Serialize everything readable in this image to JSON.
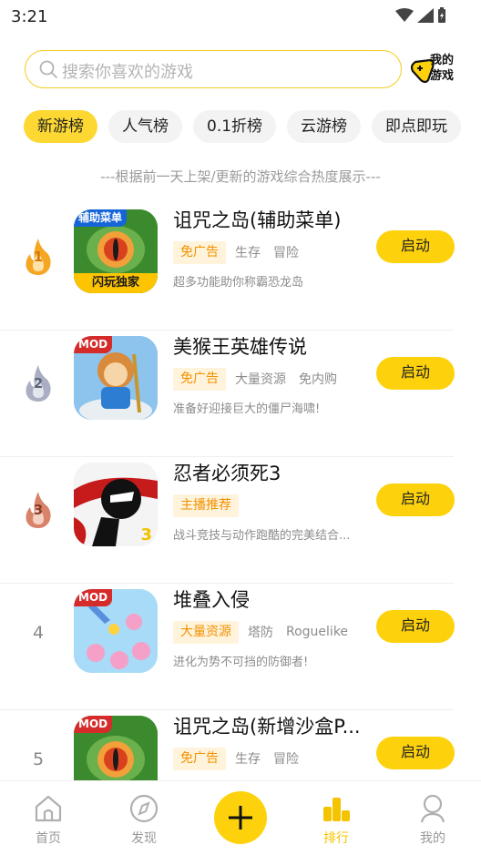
{
  "status_bar": {
    "time": "3:21"
  },
  "search": {
    "placeholder": "搜索你喜欢的游戏"
  },
  "my_games": {
    "line1": "我的",
    "line2": "游戏"
  },
  "tabs": [
    {
      "label": "新游榜",
      "active": true
    },
    {
      "label": "人气榜",
      "active": false
    },
    {
      "label": "0.1折榜",
      "active": false
    },
    {
      "label": "云游榜",
      "active": false
    },
    {
      "label": "即点即玩",
      "active": false
    }
  ],
  "notice": "---根据前一天上架/更新的游戏综合热度展示---",
  "games": [
    {
      "rank": "1",
      "title": "诅咒之岛(辅助菜单)",
      "highlight_tag": "免广告",
      "tags": [
        "生存",
        "冒险"
      ],
      "desc": "超多功能助你称霸恐龙岛",
      "button": "启动",
      "icon_badge": "辅助菜单",
      "icon_bottom": "闪玩独家"
    },
    {
      "rank": "2",
      "title": "美猴王英雄传说",
      "highlight_tag": "免广告",
      "tags": [
        "大量资源",
        "免内购"
      ],
      "desc": "准备好迎接巨大的僵尸海啸!",
      "button": "启动",
      "icon_badge": "MOD"
    },
    {
      "rank": "3",
      "title": "忍者必须死3",
      "highlight_tag": "主播推荐",
      "tags": [],
      "desc": "战斗竞技与动作跑酷的完美结合...",
      "button": "启动",
      "icon_corner": "3"
    },
    {
      "rank": "4",
      "title": "堆叠入侵",
      "highlight_tag": "大量资源",
      "tags": [
        "塔防",
        "Roguelike"
      ],
      "desc": "进化为势不可挡的防御者!",
      "button": "启动",
      "icon_badge": "MOD"
    },
    {
      "rank": "5",
      "title": "诅咒之岛(新增沙盒P...",
      "highlight_tag": "免广告",
      "tags": [
        "生存",
        "冒险"
      ],
      "desc": "",
      "button": "启动",
      "icon_badge": "MOD"
    }
  ],
  "bottom_nav": [
    {
      "label": "首页",
      "icon": "home-icon",
      "active": false
    },
    {
      "label": "发现",
      "icon": "compass-icon",
      "active": false
    },
    {
      "label": "",
      "icon": "plus-icon",
      "active": false
    },
    {
      "label": "排行",
      "icon": "ranking-icon",
      "active": true
    },
    {
      "label": "我的",
      "icon": "user-icon",
      "active": false
    }
  ],
  "colors": {
    "accent": "#fdd20d",
    "tag_bg": "#fff3dc",
    "tag_text": "#f29200",
    "gold": "#f5a623",
    "silver": "#a9aec2",
    "bronze": "#d9826a"
  }
}
